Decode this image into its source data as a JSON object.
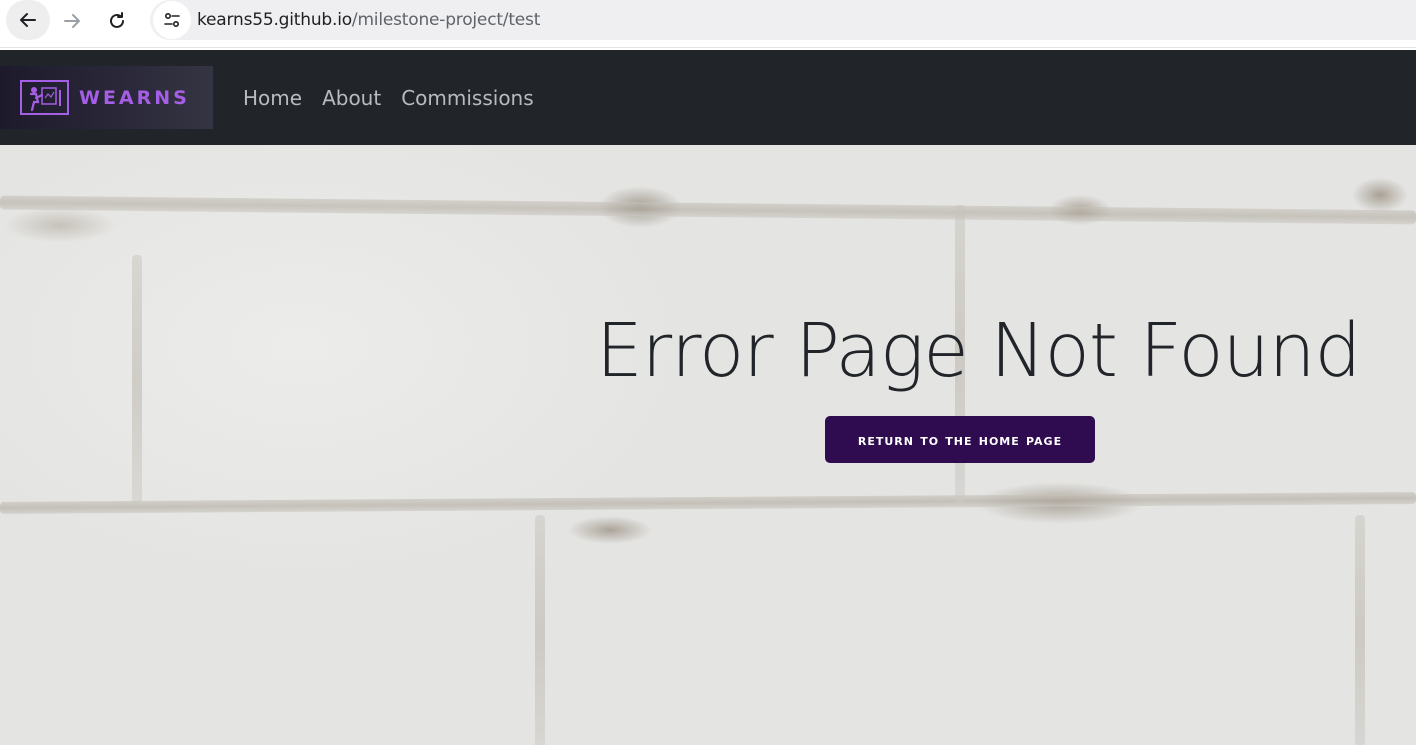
{
  "browser": {
    "url_host": "kearns55.github.io",
    "url_path": "/milestone-project/test"
  },
  "navbar": {
    "brand_text": "WEARNS",
    "brand_color": "#a55ee6",
    "background": "#212529",
    "links": [
      {
        "label": "Home"
      },
      {
        "label": "About"
      },
      {
        "label": "Commissions"
      }
    ]
  },
  "hero": {
    "title": "Error Page Not Found",
    "button_label": "Return to the home page",
    "button_color": "#2f0b50"
  },
  "icons": [
    "back-arrow-icon",
    "forward-arrow-icon",
    "reload-icon",
    "site-settings-icon",
    "brand-logo-icon"
  ]
}
